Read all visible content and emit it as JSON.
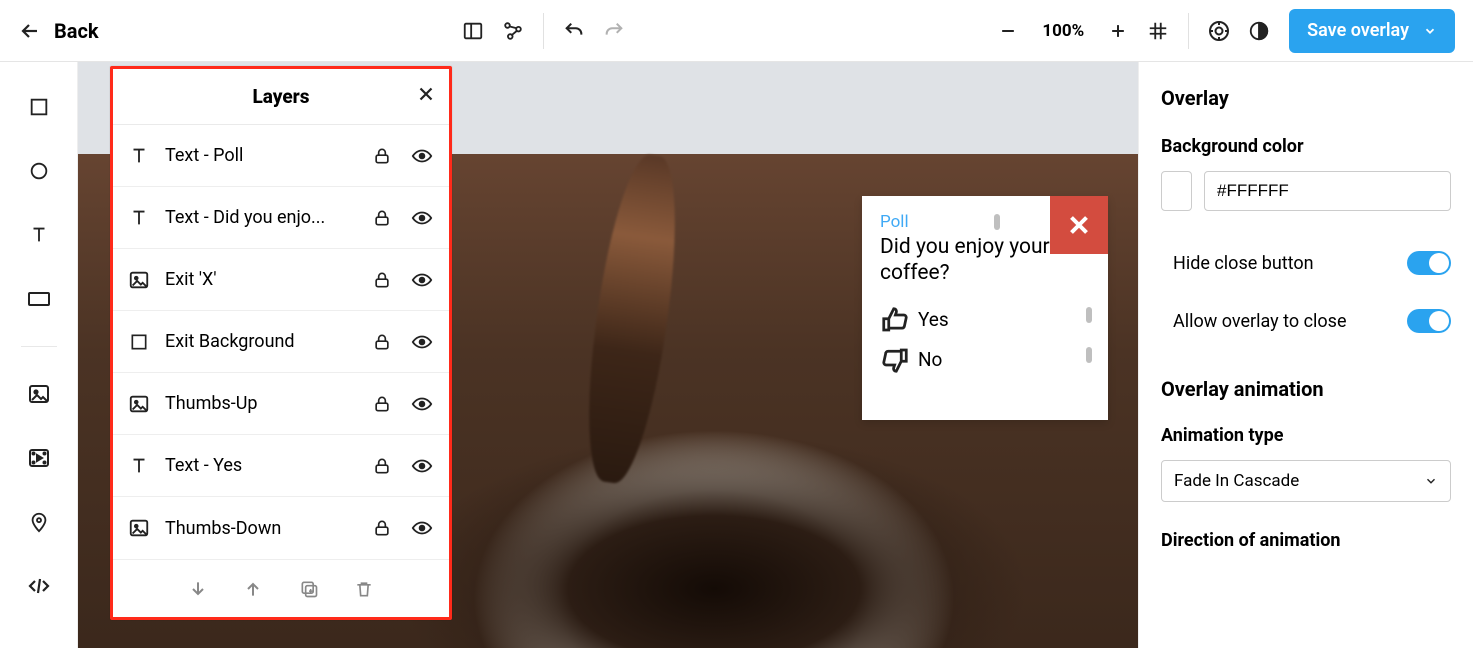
{
  "topbar": {
    "back": "Back",
    "zoom": "100%",
    "save": "Save overlay"
  },
  "layers": {
    "title": "Layers",
    "items": [
      {
        "icon": "text",
        "label": "Text - Poll"
      },
      {
        "icon": "text",
        "label": "Text - Did you enjo..."
      },
      {
        "icon": "image",
        "label": "Exit 'X'"
      },
      {
        "icon": "rect",
        "label": "Exit Background"
      },
      {
        "icon": "image",
        "label": "Thumbs-Up"
      },
      {
        "icon": "text",
        "label": "Text - Yes"
      },
      {
        "icon": "image",
        "label": "Thumbs-Down"
      }
    ]
  },
  "overlay_card": {
    "poll": "Poll",
    "question": "Did you enjoy your coffee?",
    "yes": "Yes",
    "no": "No"
  },
  "right": {
    "heading": "Overlay",
    "bg_label": "Background color",
    "bg_value": "#FFFFFF",
    "hide_close": "Hide close button",
    "allow_close": "Allow overlay to close",
    "anim_heading": "Overlay animation",
    "anim_type_label": "Animation type",
    "anim_type_value": "Fade In Cascade",
    "direction_label": "Direction of animation"
  }
}
